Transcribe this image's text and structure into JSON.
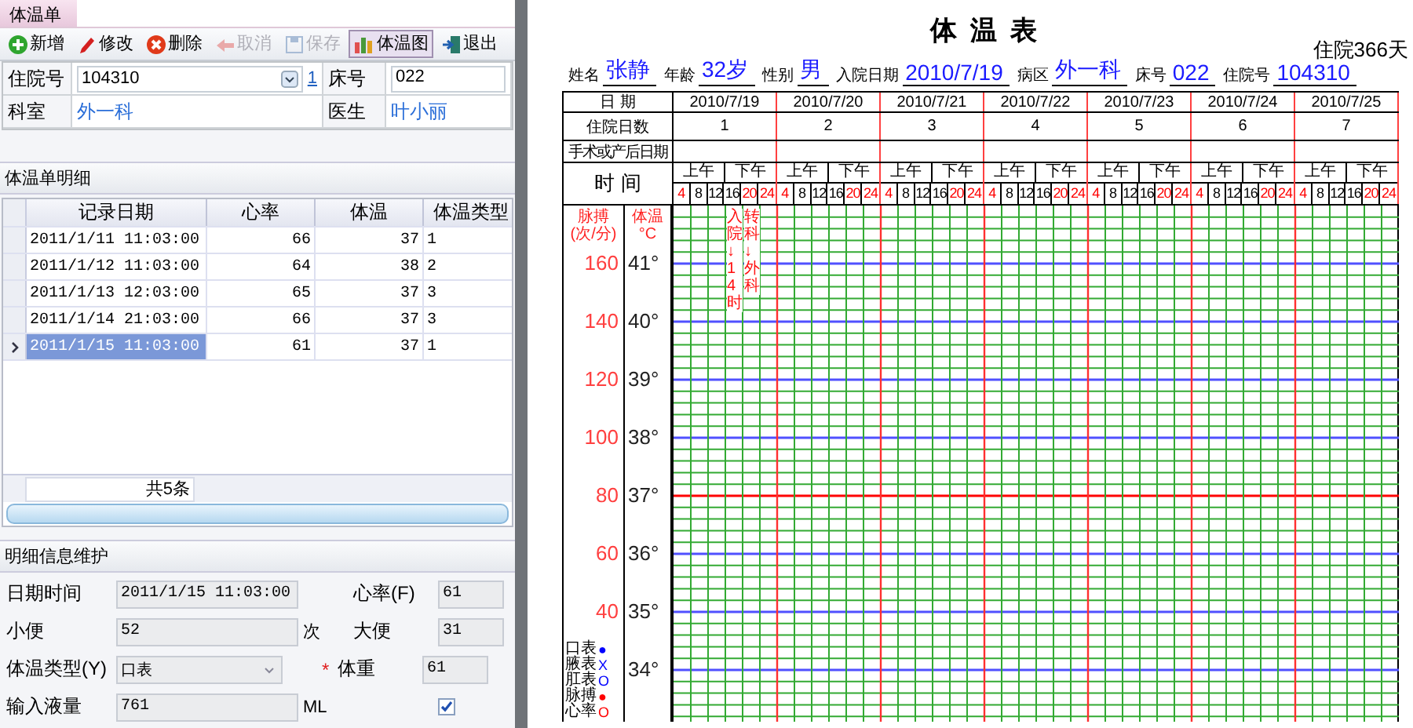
{
  "left": {
    "tab": {
      "label": "体温单",
      "selected": true
    },
    "toolbar": [
      {
        "label": "新增",
        "disabled": false,
        "selected": false
      },
      {
        "label": "修改",
        "disabled": false,
        "selected": false
      },
      {
        "label": "删除",
        "disabled": false,
        "selected": false
      },
      {
        "label": "取消",
        "disabled": true,
        "selected": false
      },
      {
        "label": "保存",
        "disabled": true,
        "selected": false
      },
      {
        "label": "体温图",
        "disabled": false,
        "selected": true
      },
      {
        "label": "退出",
        "disabled": false,
        "selected": false
      }
    ],
    "patient": {
      "admission_label": "住院号",
      "admission_value": "104310",
      "admission_link": "1",
      "bed_label": "床号",
      "bed_value": "022",
      "dept_label": "科室",
      "dept_value": "外一科",
      "doctor_label": "医生",
      "doctor_value": "叶小丽"
    },
    "detail_title": "体温单明细",
    "table": {
      "columns": [
        "记录日期",
        "心率",
        "体温",
        "体温类型"
      ],
      "rows": [
        {
          "cells": [
            "2011/1/11 11:03:00",
            "66",
            "37",
            "1"
          ],
          "selected": false
        },
        {
          "cells": [
            "2011/1/12 11:03:00",
            "64",
            "38",
            "2"
          ],
          "selected": false
        },
        {
          "cells": [
            "2011/1/13 12:03:00",
            "65",
            "37",
            "3"
          ],
          "selected": false
        },
        {
          "cells": [
            "2011/1/14 21:03:00",
            "66",
            "37",
            "3"
          ],
          "selected": false
        },
        {
          "cells": [
            "2011/1/15 11:03:00",
            "61",
            "37",
            "1"
          ],
          "selected": true
        }
      ],
      "footer": "共5条"
    },
    "maint_title": "明细信息维护",
    "form": [
      {
        "label": "日期时间",
        "value": "2011/1/15 11:03:00",
        "kind": "text",
        "right": {
          "kind": "text",
          "label": "心率(F)",
          "value": "61"
        }
      },
      {
        "label": "小便",
        "value": "52",
        "unit": "次",
        "kind": "text",
        "right": {
          "kind": "text",
          "label": "大便",
          "value": "31"
        }
      },
      {
        "label": "体温类型(Y)",
        "value": "口表",
        "kind": "select",
        "right": {
          "kind": "text",
          "label": "体重",
          "value": "61",
          "mark": "*"
        }
      },
      {
        "label": "输入液量",
        "value": "761",
        "unit": "ML",
        "kind": "text",
        "right": {
          "kind": "checkbox",
          "checked": true
        }
      }
    ]
  },
  "sheet": {
    "title": "体 温 表",
    "stay": "住院366天",
    "info": [
      {
        "label": "姓名",
        "value": "张静"
      },
      {
        "label": "年龄",
        "value": "32岁"
      },
      {
        "label": "性别",
        "value": "男"
      },
      {
        "label": "入院日期",
        "value": "2010/7/19"
      },
      {
        "label": "病区",
        "value": "外一科"
      },
      {
        "label": "床号",
        "value": "022"
      },
      {
        "label": "住院号",
        "value": "104310"
      }
    ],
    "row_labels": {
      "date": "日 期",
      "days": "住院日数",
      "surgery": "手术或产后日期",
      "time": "时 间"
    },
    "days": [
      {
        "date": "2010/7/19",
        "day": "1",
        "am": "上午",
        "pm": "下午",
        "slots": [
          {
            "label": "4",
            "color": "#ff0000"
          },
          {
            "label": "8",
            "color": "#000000"
          },
          {
            "label": "12",
            "color": "#000000"
          },
          {
            "label": "16",
            "color": "#000000"
          },
          {
            "label": "20",
            "color": "#ff0000"
          },
          {
            "label": "24",
            "color": "#ff0000"
          }
        ]
      },
      {
        "date": "2010/7/20",
        "day": "2",
        "am": "上午",
        "pm": "下午",
        "slots": [
          {
            "label": "4",
            "color": "#ff0000"
          },
          {
            "label": "8",
            "color": "#000000"
          },
          {
            "label": "12",
            "color": "#000000"
          },
          {
            "label": "16",
            "color": "#000000"
          },
          {
            "label": "20",
            "color": "#ff0000"
          },
          {
            "label": "24",
            "color": "#ff0000"
          }
        ]
      },
      {
        "date": "2010/7/21",
        "day": "3",
        "am": "上午",
        "pm": "下午",
        "slots": [
          {
            "label": "4",
            "color": "#ff0000"
          },
          {
            "label": "8",
            "color": "#000000"
          },
          {
            "label": "12",
            "color": "#000000"
          },
          {
            "label": "16",
            "color": "#000000"
          },
          {
            "label": "20",
            "color": "#ff0000"
          },
          {
            "label": "24",
            "color": "#ff0000"
          }
        ]
      },
      {
        "date": "2010/7/22",
        "day": "4",
        "am": "上午",
        "pm": "下午",
        "slots": [
          {
            "label": "4",
            "color": "#ff0000"
          },
          {
            "label": "8",
            "color": "#000000"
          },
          {
            "label": "12",
            "color": "#000000"
          },
          {
            "label": "16",
            "color": "#000000"
          },
          {
            "label": "20",
            "color": "#ff0000"
          },
          {
            "label": "24",
            "color": "#ff0000"
          }
        ]
      },
      {
        "date": "2010/7/23",
        "day": "5",
        "am": "上午",
        "pm": "下午",
        "slots": [
          {
            "label": "4",
            "color": "#ff0000"
          },
          {
            "label": "8",
            "color": "#000000"
          },
          {
            "label": "12",
            "color": "#000000"
          },
          {
            "label": "16",
            "color": "#000000"
          },
          {
            "label": "20",
            "color": "#ff0000"
          },
          {
            "label": "24",
            "color": "#ff0000"
          }
        ]
      },
      {
        "date": "2010/7/24",
        "day": "6",
        "am": "上午",
        "pm": "下午",
        "slots": [
          {
            "label": "4",
            "color": "#ff0000"
          },
          {
            "label": "8",
            "color": "#000000"
          },
          {
            "label": "12",
            "color": "#000000"
          },
          {
            "label": "16",
            "color": "#000000"
          },
          {
            "label": "20",
            "color": "#ff0000"
          },
          {
            "label": "24",
            "color": "#ff0000"
          }
        ]
      },
      {
        "date": "2010/7/25",
        "day": "7",
        "am": "上午",
        "pm": "下午",
        "slots": [
          {
            "label": "4",
            "color": "#ff0000"
          },
          {
            "label": "8",
            "color": "#000000"
          },
          {
            "label": "12",
            "color": "#000000"
          },
          {
            "label": "16",
            "color": "#000000"
          },
          {
            "label": "20",
            "color": "#ff0000"
          },
          {
            "label": "24",
            "color": "#ff0000"
          }
        ]
      }
    ],
    "pulse_label": "脉搏",
    "pulse_unit": "(次/分)",
    "temp_label": "体温",
    "temp_unit": "°C",
    "scale": [
      {
        "pulse": "160",
        "temp": "41°"
      },
      {
        "pulse": "140",
        "temp": "40°"
      },
      {
        "pulse": "120",
        "temp": "39°"
      },
      {
        "pulse": "100",
        "temp": "38°"
      },
      {
        "pulse": "80",
        "temp": "37°"
      },
      {
        "pulse": "60",
        "temp": "36°"
      },
      {
        "pulse": "40",
        "temp": "35°"
      },
      {
        "temp": "34°"
      }
    ],
    "legend": [
      {
        "label": "口表",
        "symbol": "●",
        "color": "#0000ff"
      },
      {
        "label": "腋表",
        "symbol": "X",
        "color": "#0000ff"
      },
      {
        "label": "肛表",
        "symbol": "O",
        "color": "#0000ff"
      },
      {
        "label": "脉搏",
        "symbol": "●",
        "color": "#ff0000"
      },
      {
        "label": "心率",
        "symbol": "O",
        "color": "#ff0000"
      }
    ],
    "notes": [
      "入院↓14时",
      "转科↓外科"
    ]
  }
}
